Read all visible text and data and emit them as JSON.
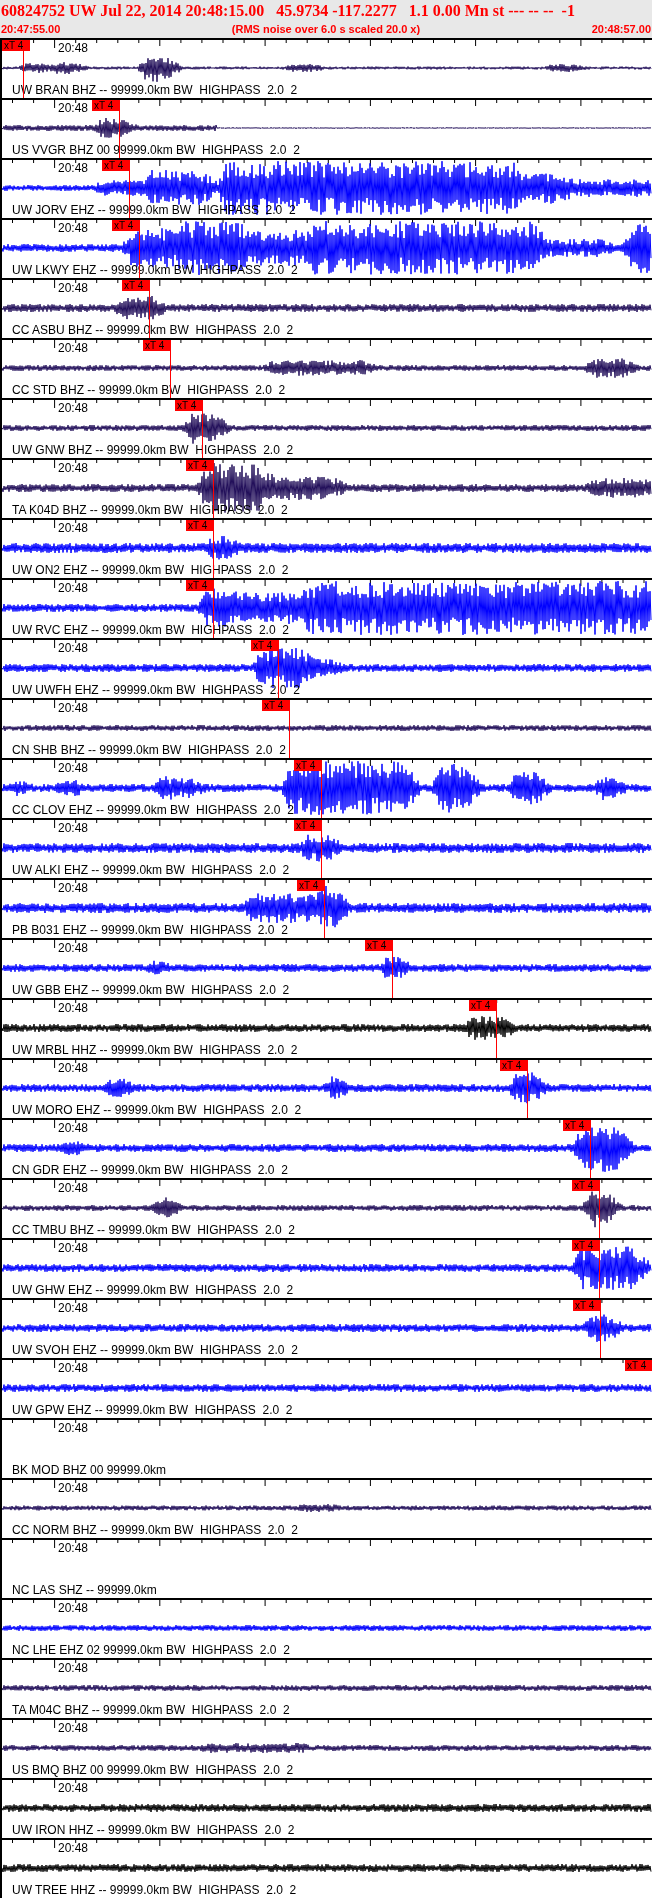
{
  "header": {
    "title": "60824752 UW Jul 22, 2014 20:48:15.00   45.9734 -117.2277   1.1 0.00 Mn st --- -- --  -1",
    "start_time": "20:47:55.00",
    "note": "(RMS noise over 6.0 s scaled 20.0 x)",
    "end_time": "20:48:57.00"
  },
  "traces": [
    {
      "label": "UW BRAN BHZ -- 99999.0km BW  HIGHPASS  2.0  2",
      "time_mark": "20:48",
      "pick": "xT 4",
      "color": "#220f5a"
    },
    {
      "label": "US VVGR BHZ 00 99999.0km BW  HIGHPASS  2.0  2",
      "time_mark": "20:48",
      "pick": "xT 4",
      "color": "#220f5a"
    },
    {
      "label": "UW JORV EHZ -- 99999.0km BW  HIGHPASS  2.0  2",
      "time_mark": "20:48",
      "pick": "xT 4",
      "color": "#0000ff"
    },
    {
      "label": "UW LKWY EHZ -- 99999.0km BW  HIGHPASS  2.0  2",
      "time_mark": "20:48",
      "pick": "xT 4",
      "color": "#0000ff"
    },
    {
      "label": "CC ASBU BHZ -- 99999.0km BW  HIGHPASS  2.0  2",
      "time_mark": "20:48",
      "pick": "xT 4",
      "color": "#220f5a"
    },
    {
      "label": "CC STD BHZ -- 99999.0km BW  HIGHPASS  2.0  2",
      "time_mark": "20:48",
      "pick": "xT 4",
      "color": "#220f5a"
    },
    {
      "label": "UW GNW BHZ -- 99999.0km BW  HIGHPASS  2.0  2",
      "time_mark": "20:48",
      "pick": "xT 4",
      "color": "#220f5a"
    },
    {
      "label": "TA K04D BHZ -- 99999.0km BW  HIGHPASS  2.0  2",
      "time_mark": "20:48",
      "pick": "xT 4",
      "color": "#220f5a"
    },
    {
      "label": "UW ON2 EHZ -- 99999.0km BW  HIGHPASS  2.0  2",
      "time_mark": "20:48",
      "pick": "xT 4",
      "color": "#0000ff"
    },
    {
      "label": "UW RVC EHZ -- 99999.0km BW  HIGHPASS  2.0  2",
      "time_mark": "20:48",
      "pick": "xT 4",
      "color": "#0000ff"
    },
    {
      "label": "UW UWFH EHZ -- 99999.0km BW  HIGHPASS  2.0  2",
      "time_mark": "20:48",
      "pick": "xT 4",
      "color": "#0000ff"
    },
    {
      "label": "CN SHB BHZ -- 99999.0km BW  HIGHPASS  2.0  2",
      "time_mark": "20:48",
      "pick": "xT 4",
      "color": "#220f5a"
    },
    {
      "label": "CC CLOV EHZ -- 99999.0km BW  HIGHPASS  2.0  2",
      "time_mark": "20:48",
      "pick": "xT 4",
      "color": "#0000ff"
    },
    {
      "label": "UW ALKI EHZ -- 99999.0km BW  HIGHPASS  2.0  2",
      "time_mark": "20:48",
      "pick": "xT 4",
      "color": "#0000ff"
    },
    {
      "label": "PB B031 EHZ -- 99999.0km BW  HIGHPASS  2.0  2",
      "time_mark": "20:48",
      "pick": "xT 4",
      "color": "#0000ff"
    },
    {
      "label": "UW GBB EHZ -- 99999.0km BW  HIGHPASS  2.0  2",
      "time_mark": "20:48",
      "pick": "xT 4",
      "color": "#0000ff"
    },
    {
      "label": "UW MRBL HHZ -- 99999.0km BW  HIGHPASS  2.0  2",
      "time_mark": "20:48",
      "pick": "xT 4",
      "color": "#000000"
    },
    {
      "label": "UW MORO EHZ -- 99999.0km BW  HIGHPASS  2.0  2",
      "time_mark": "20:48",
      "pick": "xT 4",
      "color": "#0000ff"
    },
    {
      "label": "CN GDR EHZ -- 99999.0km BW  HIGHPASS  2.0  2",
      "time_mark": "20:48",
      "pick": "xT 4",
      "color": "#0000ff"
    },
    {
      "label": "CC TMBU BHZ -- 99999.0km BW  HIGHPASS  2.0  2",
      "time_mark": "20:48",
      "pick": "xT 4",
      "color": "#220f5a"
    },
    {
      "label": "UW GHW EHZ -- 99999.0km BW  HIGHPASS  2.0  2",
      "time_mark": "20:48",
      "pick": "xT 4",
      "color": "#0000ff"
    },
    {
      "label": "UW SVOH EHZ -- 99999.0km BW  HIGHPASS  2.0  2",
      "time_mark": "20:48",
      "pick": "xT 4",
      "color": "#0000ff"
    },
    {
      "label": "UW GPW EHZ -- 99999.0km BW  HIGHPASS  2.0  2",
      "time_mark": "20:48",
      "pick": "xT 4",
      "color": "#0000ff"
    },
    {
      "label": "BK MOD BHZ 00 99999.0km",
      "time_mark": "20:48"
    },
    {
      "label": "CC NORM BHZ -- 99999.0km BW  HIGHPASS  2.0  2",
      "time_mark": "20:48",
      "color": "#220f5a"
    },
    {
      "label": "NC LAS SHZ -- 99999.0km",
      "time_mark": "20:48"
    },
    {
      "label": "NC LHE EHZ 02 99999.0km BW  HIGHPASS  2.0  2",
      "time_mark": "20:48",
      "color": "#0000ff"
    },
    {
      "label": "TA M04C BHZ -- 99999.0km BW  HIGHPASS  2.0  2",
      "time_mark": "20:48",
      "color": "#220f5a"
    },
    {
      "label": "US BMQ BHZ 00 99999.0km BW  HIGHPASS  2.0  2",
      "time_mark": "20:48",
      "color": "#220f5a"
    },
    {
      "label": "UW IRON HHZ -- 99999.0km BW  HIGHPASS  2.0  2",
      "time_mark": "20:48",
      "color": "#000000"
    },
    {
      "label": "UW TREE HHZ -- 99999.0km BW  HIGHPASS  2.0  2",
      "time_mark": "20:48",
      "color": "#000000"
    }
  ]
}
